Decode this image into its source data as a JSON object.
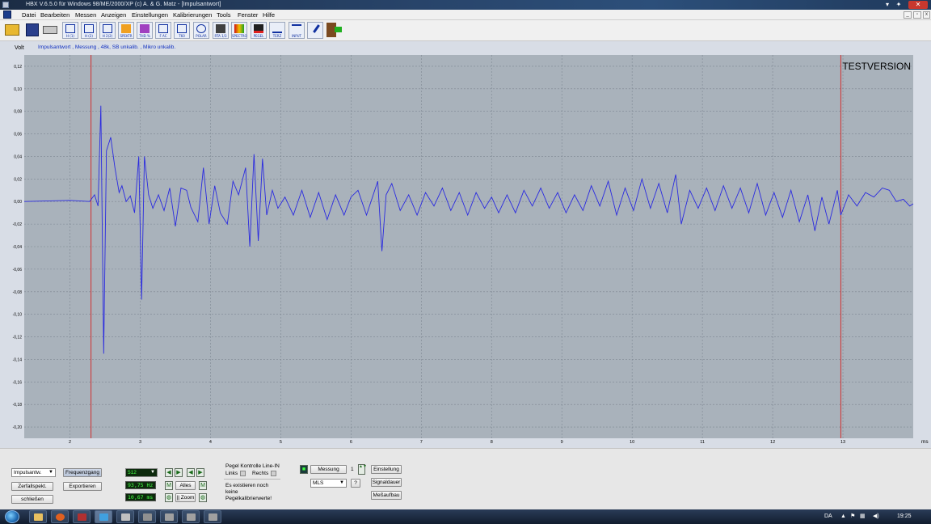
{
  "window": {
    "title": "HBX V.6.5.0   für Windows 98/ME/2000/XP    (c)   A. & G. Matz - [Impulsantwort]"
  },
  "menu": [
    "Datei",
    "Bearbeiten",
    "Messen",
    "Anzeigen",
    "Einstellungen",
    "Kalibrierungen",
    "Tools",
    "Fenster",
    "Hilfe"
  ],
  "toolbar": {
    "buttons": [
      {
        "name": "open-folder",
        "label": ""
      },
      {
        "name": "save",
        "label": ""
      },
      {
        "name": "print",
        "label": ""
      },
      {
        "name": "hi-1",
        "label": "H (1)"
      },
      {
        "name": "hi-2",
        "label": "H (2)"
      },
      {
        "name": "h-2-2",
        "label": "H 2(2)"
      },
      {
        "name": "spekt",
        "label": "SPEKTR"
      },
      {
        "name": "thd",
        "label": "THD %"
      },
      {
        "name": "fac",
        "label": "F AC"
      },
      {
        "name": "t60",
        "label": "T60"
      },
      {
        "name": "polar",
        "label": "POLAR"
      },
      {
        "name": "rta",
        "label": "RTA 1/3"
      },
      {
        "name": "spectro",
        "label": "SPECTRO"
      },
      {
        "name": "pegel",
        "label": "PEGEL"
      },
      {
        "name": "terz",
        "label": "TERZ"
      },
      {
        "name": "input",
        "label": "INPUT"
      },
      {
        "name": "mic",
        "label": ""
      },
      {
        "name": "exit",
        "label": ""
      }
    ]
  },
  "plot": {
    "y_unit": "Volt",
    "caption": "Impulsantwort , Messung , 48k, SB unkalib. , Mikro unkalib.",
    "watermark": "TESTVERSION",
    "x_unit": "ms"
  },
  "chart_data": {
    "type": "line",
    "x_unit": "ms",
    "y_unit": "Volt",
    "xlim": [
      1.35,
      14.0
    ],
    "ylim": [
      -0.21,
      0.13
    ],
    "y_ticks": [
      "0,12",
      "0,10",
      "0,08",
      "0,06",
      "0,04",
      "0,02",
      "0,00",
      "-0,02",
      "-0,04",
      "-0,06",
      "-0,08",
      "-0,10",
      "-0,12",
      "-0,14",
      "-0,16",
      "-0,18",
      "-0,20"
    ],
    "y_tick_values": [
      0.12,
      0.1,
      0.08,
      0.06,
      0.04,
      0.02,
      0.0,
      -0.02,
      -0.04,
      -0.06,
      -0.08,
      -0.1,
      -0.12,
      -0.14,
      -0.16,
      -0.18,
      -0.2
    ],
    "x_ticks": [
      "2",
      "3",
      "4",
      "5",
      "6",
      "7",
      "8",
      "9",
      "10",
      "11",
      "12",
      "13"
    ],
    "x_tick_values": [
      2,
      3,
      4,
      5,
      6,
      7,
      8,
      9,
      10,
      11,
      12,
      13
    ],
    "markers": [
      {
        "x": 2.3
      },
      {
        "x": 12.97
      }
    ],
    "grid": true,
    "series": [
      {
        "color": "#2a2ae0",
        "points": [
          [
            1.35,
            0.0
          ],
          [
            2.0,
            0.001
          ],
          [
            2.28,
            0.0
          ],
          [
            2.35,
            0.006
          ],
          [
            2.4,
            -0.004
          ],
          [
            2.44,
            0.085
          ],
          [
            2.48,
            -0.135
          ],
          [
            2.52,
            0.045
          ],
          [
            2.58,
            0.057
          ],
          [
            2.64,
            0.03
          ],
          [
            2.7,
            0.008
          ],
          [
            2.74,
            0.014
          ],
          [
            2.8,
            0.0
          ],
          [
            2.86,
            0.005
          ],
          [
            2.92,
            -0.01
          ],
          [
            2.98,
            0.04
          ],
          [
            3.02,
            -0.087
          ],
          [
            3.06,
            0.04
          ],
          [
            3.12,
            0.006
          ],
          [
            3.18,
            -0.006
          ],
          [
            3.26,
            0.006
          ],
          [
            3.34,
            -0.008
          ],
          [
            3.42,
            0.012
          ],
          [
            3.5,
            -0.022
          ],
          [
            3.58,
            0.012
          ],
          [
            3.66,
            0.01
          ],
          [
            3.72,
            -0.005
          ],
          [
            3.82,
            -0.018
          ],
          [
            3.9,
            0.03
          ],
          [
            3.98,
            -0.02
          ],
          [
            4.06,
            0.014
          ],
          [
            4.14,
            -0.01
          ],
          [
            4.24,
            -0.02
          ],
          [
            4.32,
            0.018
          ],
          [
            4.4,
            0.006
          ],
          [
            4.5,
            0.03
          ],
          [
            4.56,
            -0.04
          ],
          [
            4.62,
            0.042
          ],
          [
            4.68,
            -0.035
          ],
          [
            4.74,
            0.038
          ],
          [
            4.8,
            -0.012
          ],
          [
            4.88,
            0.01
          ],
          [
            4.96,
            -0.006
          ],
          [
            5.06,
            0.004
          ],
          [
            5.18,
            -0.012
          ],
          [
            5.3,
            0.01
          ],
          [
            5.42,
            -0.014
          ],
          [
            5.54,
            0.008
          ],
          [
            5.66,
            -0.016
          ],
          [
            5.78,
            0.006
          ],
          [
            5.9,
            -0.012
          ],
          [
            6.0,
            0.004
          ],
          [
            6.1,
            0.01
          ],
          [
            6.22,
            -0.012
          ],
          [
            6.38,
            0.018
          ],
          [
            6.44,
            -0.044
          ],
          [
            6.5,
            0.006
          ],
          [
            6.58,
            0.016
          ],
          [
            6.7,
            -0.008
          ],
          [
            6.82,
            0.006
          ],
          [
            6.94,
            -0.012
          ],
          [
            7.06,
            0.008
          ],
          [
            7.18,
            -0.004
          ],
          [
            7.3,
            0.012
          ],
          [
            7.42,
            -0.008
          ],
          [
            7.54,
            0.008
          ],
          [
            7.66,
            -0.012
          ],
          [
            7.78,
            0.008
          ],
          [
            7.9,
            -0.006
          ],
          [
            8.0,
            0.004
          ],
          [
            8.1,
            -0.01
          ],
          [
            8.22,
            0.006
          ],
          [
            8.34,
            -0.01
          ],
          [
            8.46,
            0.01
          ],
          [
            8.58,
            -0.004
          ],
          [
            8.7,
            0.012
          ],
          [
            8.82,
            -0.006
          ],
          [
            8.94,
            0.008
          ],
          [
            9.06,
            -0.01
          ],
          [
            9.18,
            0.006
          ],
          [
            9.3,
            -0.008
          ],
          [
            9.42,
            0.014
          ],
          [
            9.54,
            -0.004
          ],
          [
            9.66,
            0.018
          ],
          [
            9.78,
            -0.012
          ],
          [
            9.9,
            0.012
          ],
          [
            10.02,
            -0.008
          ],
          [
            10.14,
            0.02
          ],
          [
            10.26,
            -0.006
          ],
          [
            10.38,
            0.016
          ],
          [
            10.5,
            -0.01
          ],
          [
            10.62,
            0.024
          ],
          [
            10.7,
            -0.02
          ],
          [
            10.82,
            0.01
          ],
          [
            10.94,
            -0.006
          ],
          [
            11.06,
            0.012
          ],
          [
            11.18,
            -0.008
          ],
          [
            11.3,
            0.014
          ],
          [
            11.42,
            -0.006
          ],
          [
            11.54,
            0.012
          ],
          [
            11.66,
            -0.01
          ],
          [
            11.78,
            0.016
          ],
          [
            11.9,
            -0.012
          ],
          [
            12.02,
            0.008
          ],
          [
            12.14,
            -0.014
          ],
          [
            12.26,
            0.01
          ],
          [
            12.38,
            -0.018
          ],
          [
            12.5,
            0.006
          ],
          [
            12.6,
            -0.026
          ],
          [
            12.7,
            0.004
          ],
          [
            12.8,
            -0.02
          ],
          [
            12.92,
            0.01
          ],
          [
            12.97,
            -0.012
          ],
          [
            13.08,
            0.006
          ],
          [
            13.2,
            -0.004
          ],
          [
            13.32,
            0.008
          ],
          [
            13.44,
            0.004
          ],
          [
            13.56,
            0.012
          ],
          [
            13.66,
            0.01
          ],
          [
            13.76,
            0.0
          ],
          [
            13.86,
            0.002
          ],
          [
            13.95,
            -0.004
          ],
          [
            14.0,
            -0.002
          ]
        ]
      }
    ]
  },
  "panel": {
    "view_select": "Impulsantw.",
    "frequenzgang": "Frequenzgang",
    "zerfallspekt": "Zerfallspekt.",
    "exportieren": "Exportieren",
    "schliessen": "schließen",
    "fft_size": "512",
    "resolution": "93,75 Hz",
    "window_len": "10,67 ms",
    "alles": "Alles",
    "zoom": "|| Zoom",
    "pegel_title": "Pegel Kontrolle Line-IN",
    "links": "Links",
    "rechts": "Rechts",
    "pegel_info": [
      "Es existieren noch",
      "keine",
      "Pegelkalibrierwerte!"
    ],
    "messung": "Messung",
    "count": "1",
    "mode": "MLS",
    "help": "?",
    "einstellung": "Einstellung",
    "signaldauer": "Signaldauer",
    "messaufbau": "Meßaufbau"
  },
  "taskbar": {
    "lang": "DA",
    "time": "19:25"
  },
  "colors": {
    "plot_bg": "#a9b2bb",
    "trace": "#2a2ae0",
    "marker": "#d03030",
    "grid": "#7e8792"
  }
}
